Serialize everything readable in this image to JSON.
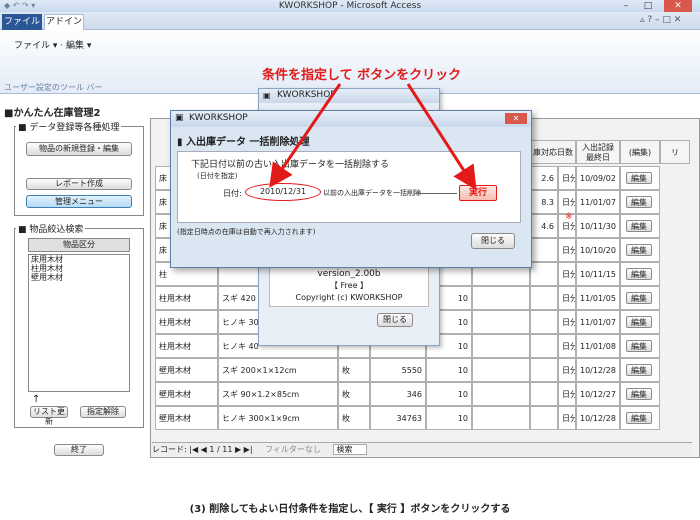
{
  "window": {
    "title": "KWORKSHOP - Microsoft Access",
    "minimize": "–",
    "maximize": "□",
    "close": "✕"
  },
  "ribbon": {
    "tab_file": "ファイル",
    "tab_addin": "アドイン",
    "menu_file": "ファイル",
    "menu_edit": "編集",
    "toolbar_group_label": "ユーザー設定のツール バー"
  },
  "form": {
    "title": "■かんたん在庫管理2",
    "group1_title": "■ データ登録等各種処理",
    "btn_new_product": "物品の新規登録・編集",
    "btn_report": "レポート作成",
    "btn_admin_menu": "管理メニュー",
    "group2_title": "■ 物品絞込検索",
    "category_label": "物品区分",
    "categories": [
      "床用木材",
      "柱用木材",
      "壁用木材"
    ],
    "arrow": "↑",
    "btn_refresh_list": "リスト更新",
    "btn_clear_filter": "指定解除",
    "btn_exit": "終了"
  },
  "sheet": {
    "header_last_date": "入出記録\n最終日",
    "header_edit": "(編集)",
    "header_dayscol": "庫対応日数",
    "header_extra": "リ",
    "rows": [
      {
        "c1": "床",
        "c2": "",
        "c3": "",
        "c4": "",
        "c5": "",
        "days": "2.6",
        "unit": "日分",
        "date": "10/09/02",
        "edit": "編集",
        "mark": ""
      },
      {
        "c1": "床",
        "c2": "",
        "c3": "",
        "c4": "",
        "c5": "",
        "days": "8.3",
        "unit": "日分",
        "date": "11/01/07",
        "edit": "編集",
        "mark": ""
      },
      {
        "c1": "床",
        "c2": "",
        "c3": "",
        "c4": "",
        "c5": "",
        "days": "4.6",
        "unit": "日分",
        "date": "10/11/30",
        "edit": "編集",
        "mark": "※"
      },
      {
        "c1": "床",
        "c2": "",
        "c3": "",
        "c4": "",
        "c5": "",
        "days": "",
        "unit": "日分",
        "date": "10/10/20",
        "edit": "編集",
        "mark": ""
      },
      {
        "c1": "柱",
        "c2": "",
        "c3": "",
        "c4": "",
        "c5": "",
        "days": "",
        "unit": "日分",
        "date": "10/11/15",
        "edit": "編集",
        "mark": ""
      },
      {
        "c1": "柱用木材",
        "c2": "スギ 420",
        "c3": "",
        "c4": "",
        "c5": "10",
        "days": "",
        "unit": "日分",
        "date": "11/01/05",
        "edit": "編集",
        "mark": ""
      },
      {
        "c1": "柱用木材",
        "c2": "ヒノキ 30",
        "c3": "",
        "c4": "",
        "c5": "10",
        "days": "",
        "unit": "日分",
        "date": "11/01/07",
        "edit": "編集",
        "mark": ""
      },
      {
        "c1": "柱用木材",
        "c2": "ヒノキ 40",
        "c3": "",
        "c4": "",
        "c5": "10",
        "days": "",
        "unit": "日分",
        "date": "11/01/08",
        "edit": "編集",
        "mark": ""
      },
      {
        "c1": "壁用木材",
        "c2": "スギ 200×1×12cm",
        "c3": "枚",
        "c4": "5550",
        "c5": "10",
        "days": "",
        "unit": "日分",
        "date": "10/12/28",
        "edit": "編集",
        "mark": ""
      },
      {
        "c1": "壁用木材",
        "c2": "スギ 90×1.2×85cm",
        "c3": "枚",
        "c4": "346",
        "c5": "10",
        "days": "",
        "unit": "日分",
        "date": "10/12/27",
        "edit": "編集",
        "mark": ""
      },
      {
        "c1": "壁用木材",
        "c2": "ヒノキ 300×1×9cm",
        "c3": "枚",
        "c4": "34763",
        "c5": "10",
        "days": "",
        "unit": "日分",
        "date": "10/12/28",
        "edit": "編集",
        "mark": ""
      }
    ],
    "nav_label": "レコード:",
    "nav_first": "|◀",
    "nav_prev": "◀",
    "nav_position": "1 / 11",
    "nav_next": "▶",
    "nav_last": "▶|",
    "nav_filter": "フィルターなし",
    "nav_search": "検索"
  },
  "version_window": {
    "title": "KWORKSHOP",
    "version": "version_2.00b",
    "edition": "【 Free 】",
    "copyright": "Copyright (c) KWORKSHOP",
    "btn_close": "閉じる"
  },
  "dialog": {
    "title": "KWORKSHOP",
    "heading": "入出庫データ 一括削除処理",
    "description": "下記日付以前の古い入出庫データを一括削除する",
    "sub_note": "(日付を指定)",
    "date_label": "日付:",
    "date_value": "2010/12/31",
    "after_date_text": "以前の入出庫データを一括削除",
    "btn_execute": "実行",
    "footnote": "(指定日時点の在庫は自動で再入力されます)",
    "btn_close": "閉じる"
  },
  "annotation": {
    "instruction": "条件を指定して ボタンをクリック",
    "caption": "(3) 削除してもよい日付条件を指定し、【 実行 】ボタンをクリックする",
    "color": "#e31a1a"
  }
}
